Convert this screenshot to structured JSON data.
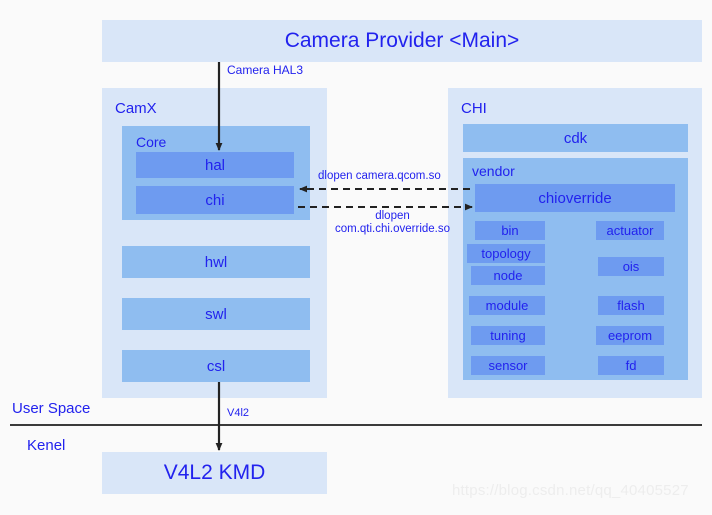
{
  "diagram": {
    "title_box": {
      "label": "Camera Provider <Main>"
    },
    "left_panel": {
      "title": "CamX",
      "core": {
        "title": "Core",
        "boxes": [
          {
            "label": "hal"
          },
          {
            "label": "chi"
          }
        ]
      },
      "layers": [
        {
          "label": "hwl"
        },
        {
          "label": "swl"
        },
        {
          "label": "csl"
        }
      ]
    },
    "right_panel": {
      "title": "CHI",
      "cdk": {
        "label": "cdk"
      },
      "vendor": {
        "title": "vendor",
        "override": {
          "label": "chioverride"
        },
        "left_column": [
          {
            "label": "bin"
          },
          {
            "label": "topology"
          },
          {
            "label": "node"
          },
          {
            "label": "module"
          },
          {
            "label": "tuning"
          },
          {
            "label": "sensor"
          }
        ],
        "right_column": [
          {
            "label": "actuator"
          },
          {
            "label": "ois"
          },
          {
            "label": "flash"
          },
          {
            "label": "eeprom"
          },
          {
            "label": "fd"
          }
        ]
      }
    },
    "kernel_box": {
      "label": "V4L2 KMD"
    },
    "edges": {
      "camera_hal3": "Camera HAL3",
      "v4l2": "V4l2",
      "dlopen_to_camx": "dlopen camera.qcom.so",
      "dlopen_to_chi_line1": "dlopen",
      "dlopen_to_chi_line2": "com.qti.chi.override.so"
    },
    "space_labels": {
      "user": "User Space",
      "kernel": "Kenel"
    },
    "watermark": "https://blog.csdn.net/qq_40405527",
    "colors": {
      "background": "#fafafa",
      "pale_blue": "#d9e6f8",
      "mid_blue": "#8fbdf0",
      "deep_blue": "#6e9bf0",
      "text_blue": "#2222ee",
      "line_dark": "#3a3a3a"
    }
  }
}
